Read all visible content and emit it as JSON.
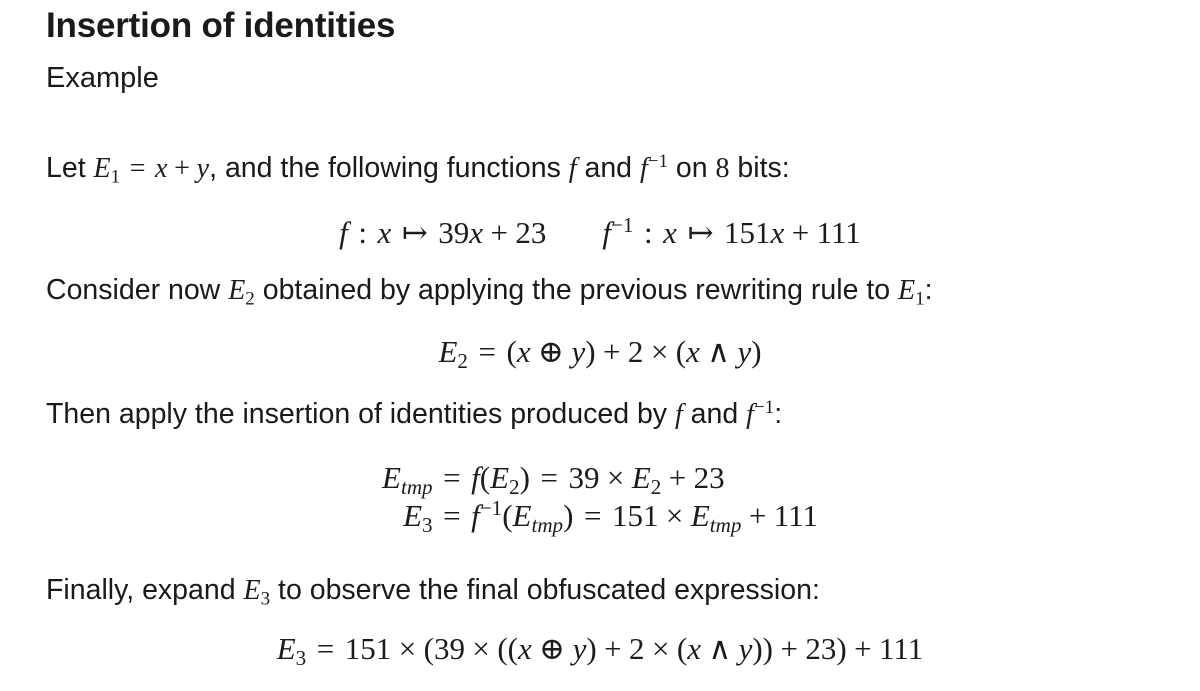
{
  "slide": {
    "frame_title": "Insertion of identities",
    "block_title": "Example",
    "background_color": "#ffffff",
    "text_color": "#1a1a1a"
  },
  "paragraph_1": {
    "t1": "Let ",
    "E1": "E",
    "E1_sub": "1",
    "eq": "=",
    "x": "x",
    "plus": "+",
    "y": "y",
    "t2": ", and the following functions ",
    "f": "f",
    "t3": " and ",
    "finv": "f",
    "finv_sup": "−1",
    "t4": " on ",
    "bits": "8",
    "t5": " bits:"
  },
  "equation_functions": {
    "f": "f",
    "colon": ":",
    "x": "x",
    "mapsto": "↦",
    "coef_f": "39",
    "var_f": "x",
    "plus": "+",
    "const_f": "23",
    "finv": "f",
    "finv_sup": "−1",
    "colon2": ":",
    "x2": "x",
    "mapsto2": "↦",
    "coef_finv": "151",
    "var_finv": "x",
    "plus2": "+",
    "const_finv": "111"
  },
  "paragraph_2": {
    "t1": "Consider now ",
    "E2": "E",
    "E2_sub": "2",
    "t2": " obtained by applying the previous rewriting rule to ",
    "E1": "E",
    "E1_sub": "1",
    "t3": ":"
  },
  "equation_e2": {
    "lhs": "E",
    "lhs_sub": "2",
    "eq": "=",
    "open1": "(",
    "x": "x",
    "xor": "⊕",
    "y": "y",
    "close1": ")",
    "plus": "+",
    "two": "2",
    "times": "×",
    "open2": "(",
    "x2": "x",
    "and": "∧",
    "y2": "y",
    "close2": ")"
  },
  "paragraph_3": {
    "t1": "Then apply the insertion of identities produced by ",
    "f": "f",
    "t2": " and ",
    "finv": "f",
    "finv_sup": "−1",
    "t3": ":"
  },
  "equation_identities": {
    "line1": {
      "lhs": "E",
      "lhs_sub": "tmp",
      "eq1": "=",
      "f": "f",
      "open": "(",
      "arg": "E",
      "arg_sub": "2",
      "close": ")",
      "eq2": "=",
      "coef": "39",
      "times": "×",
      "var": "E",
      "var_sub": "2",
      "plus": "+",
      "const": "23"
    },
    "line2": {
      "lhs": "E",
      "lhs_sub": "3",
      "eq1": "=",
      "f": "f",
      "f_sup": "−1",
      "open": "(",
      "arg": "E",
      "arg_sub": "tmp",
      "close": ")",
      "eq2": "=",
      "coef": "151",
      "times": "×",
      "var": "E",
      "var_sub": "tmp",
      "plus": "+",
      "const": "111"
    }
  },
  "paragraph_4": {
    "t1": "Finally, expand ",
    "E3": "E",
    "E3_sub": "3",
    "t2": " to observe the final obfuscated expression:"
  },
  "equation_final": {
    "lhs": "E",
    "lhs_sub": "3",
    "eq": "=",
    "outer_coef": "151",
    "times1": "×",
    "open_outer": "(",
    "inner_coef": "39",
    "times2": "×",
    "open_mid": "(",
    "open_in1": "(",
    "x": "x",
    "xor": "⊕",
    "y": "y",
    "close_in1": ")",
    "plus1": "+",
    "two": "2",
    "times3": "×",
    "open_in2": "(",
    "x2": "x",
    "and": "∧",
    "y2": "y",
    "close_in2": ")",
    "close_mid": ")",
    "plus2": "+",
    "const_inner": "23",
    "close_outer": ")",
    "plus3": "+",
    "const_outer": "111"
  }
}
